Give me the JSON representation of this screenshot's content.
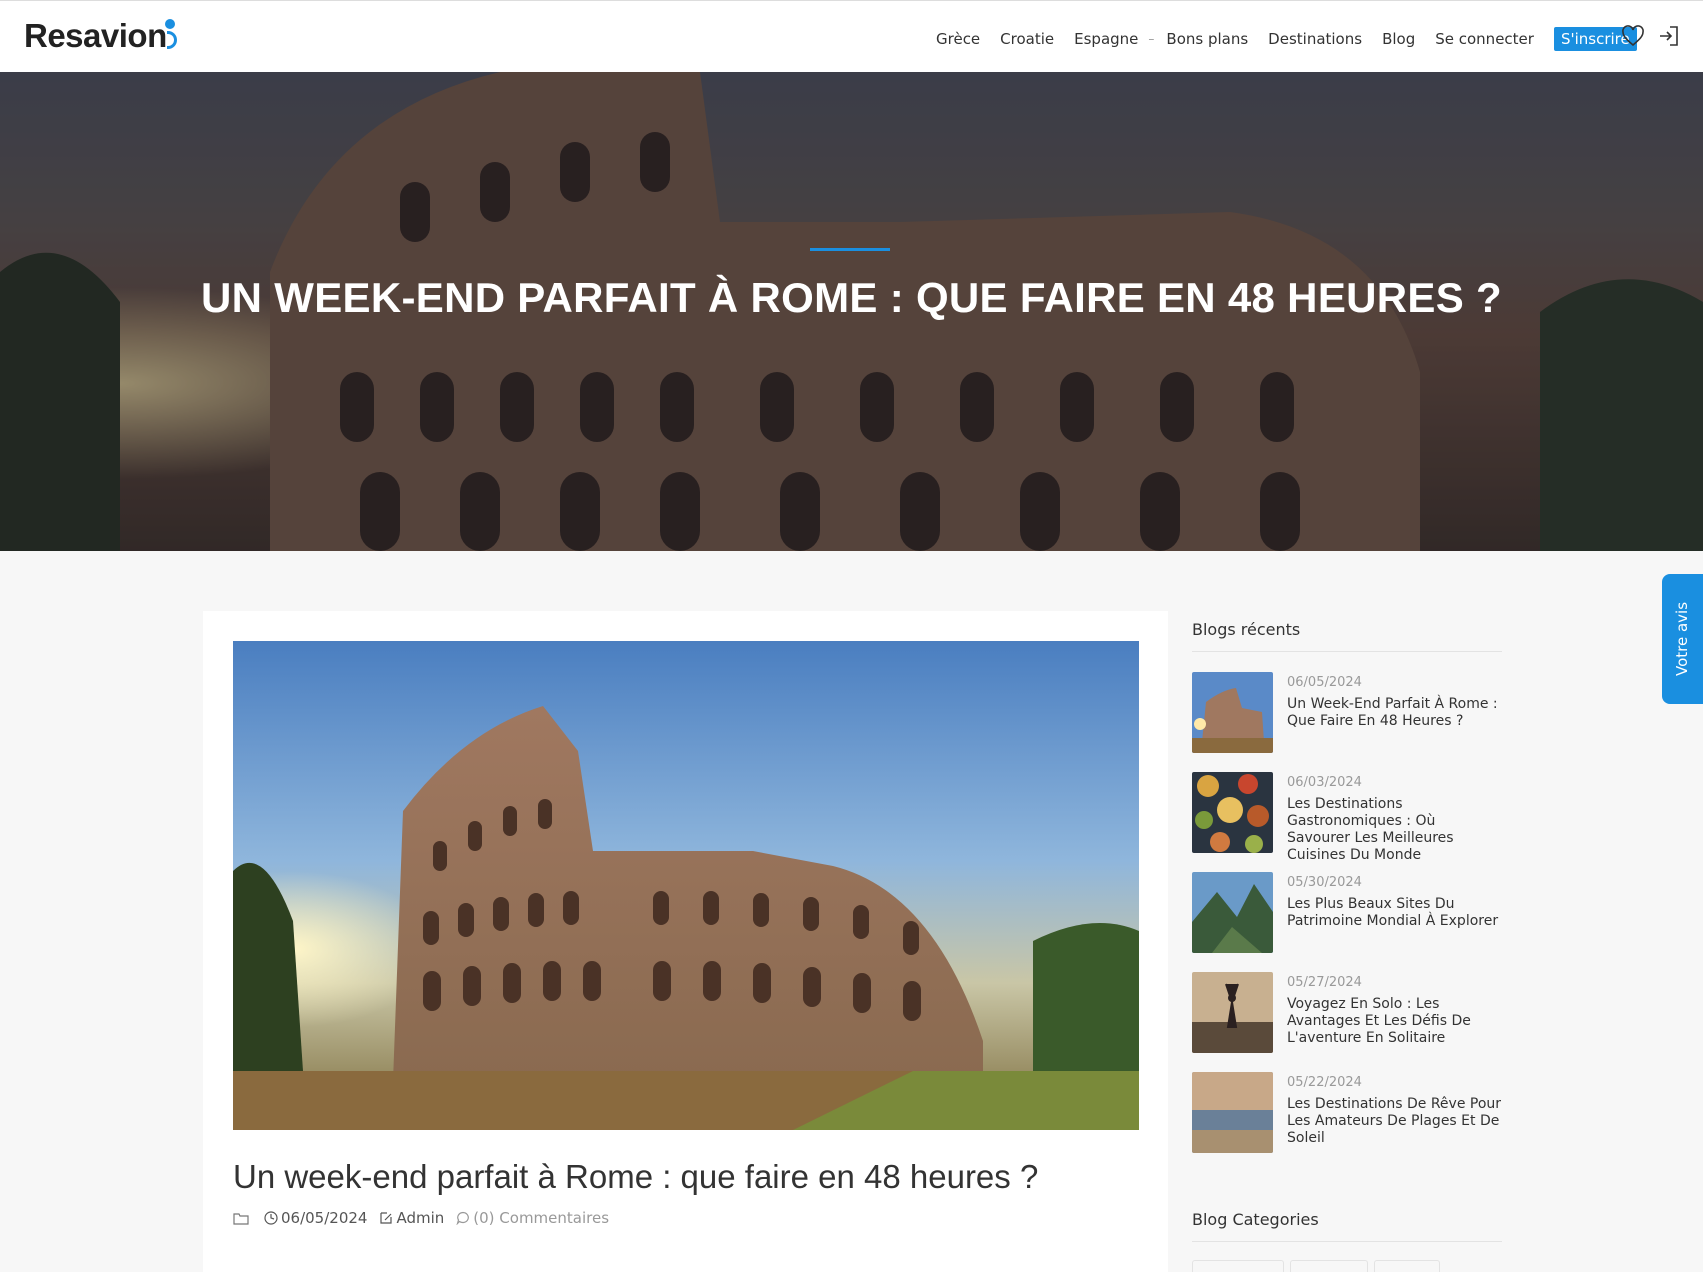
{
  "header": {
    "logo": "Resavion",
    "nav": [
      {
        "label": "Grèce"
      },
      {
        "label": "Croatie"
      },
      {
        "label": "Espagne"
      },
      {
        "label": "Bons plans"
      },
      {
        "label": "Destinations"
      },
      {
        "label": "Blog"
      },
      {
        "label": "Se connecter"
      },
      {
        "label": "S'inscrire"
      }
    ],
    "nav_separator": "–",
    "icons": [
      "heart-icon",
      "login-icon"
    ]
  },
  "hero": {
    "title": "UN WEEK-END PARFAIT À ROME : QUE FAIRE EN 48 HEURES ?"
  },
  "feedback_tab": "Votre avis",
  "post": {
    "title": "Un week-end parfait à Rome : que faire en 48 heures ?",
    "date": "06/05/2024",
    "author": "Admin",
    "comments": "(0) Commentaires"
  },
  "sidebar": {
    "recent_heading": "Blogs récents",
    "recent": [
      {
        "date": "06/05/2024",
        "title": "Un Week-End Parfait À Rome : Que Faire En 48 Heures ?"
      },
      {
        "date": "06/03/2024",
        "title": "Les Destinations Gastronomiques : Où Savourer Les Meilleures Cuisines Du Monde"
      },
      {
        "date": "05/30/2024",
        "title": "Les Plus Beaux Sites Du Patrimoine Mondial À Explorer"
      },
      {
        "date": "05/27/2024",
        "title": "Voyagez En Solo : Les Avantages Et Les Défis De L'aventure En Solitaire"
      },
      {
        "date": "05/22/2024",
        "title": "Les Destinations De Rêve Pour Les Amateurs De Plages Et De Soleil"
      }
    ],
    "categories_heading": "Blog Categories"
  },
  "colors": {
    "accent": "#1a8fe0",
    "text": "#333333",
    "muted": "#999999",
    "background": "#f7f7f7"
  }
}
